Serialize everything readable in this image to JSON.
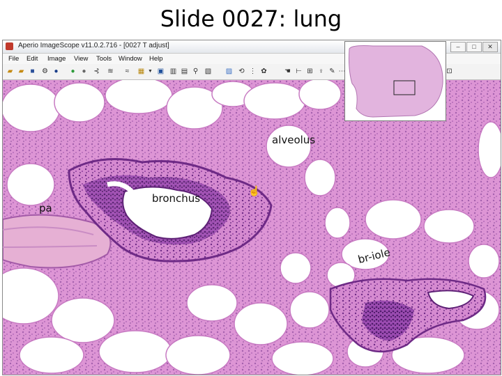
{
  "slide": {
    "title": "Slide 0027: lung"
  },
  "window": {
    "title": "Aperio ImageScope v11.0.2.716 - [0027 T adjust]",
    "minimize_icon": "minimize-icon",
    "maximize_icon": "maximize-icon",
    "close_icon": "close-icon"
  },
  "menu": [
    "File",
    "Edit",
    "Image",
    "View",
    "Tools",
    "Window",
    "Help"
  ],
  "toolbar": {
    "icons": [
      "open-folder-icon",
      "open-url-icon",
      "save-icon",
      "settings-icon",
      "info-icon",
      "go-forward-icon",
      "go-back-icon",
      "connect-icon",
      "layers-icon",
      "select-region-icon",
      "dropdown-icon",
      "panel-icon",
      "bookmark-icon",
      "zoom-window-icon",
      "magnifier-icon",
      "snapshot-icon",
      "compare-icon",
      "sync-icon",
      "track-icon",
      "group-icon",
      "pan-hand-icon",
      "ruler-icon",
      "grid-icon",
      "marker-icon",
      "pen-icon",
      "dots-icon",
      "line-icon",
      "rectangle-icon",
      "ellipse-icon",
      "arrow-icon",
      "text-icon",
      "color-icon",
      "color-picker-icon",
      "dropdown-icon",
      "help-icon"
    ]
  },
  "labels": {
    "alveolus": "alveolus",
    "bronchus": "bronchus",
    "pa": "pa",
    "bronchiole": "br-iole"
  },
  "colors": {
    "tissue": "#d98ad3",
    "tissue_dark": "#7a2f8c",
    "background": "#fbf7fb",
    "vessel": "#e9b2d6"
  },
  "cursor": "hand-cursor-icon"
}
